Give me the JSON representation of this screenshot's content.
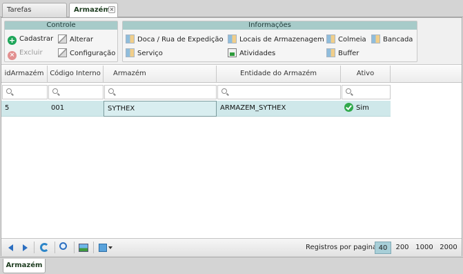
{
  "tabs": [
    {
      "label": "Tarefas Principais",
      "active": false
    },
    {
      "label": "Armazém",
      "active": true,
      "closable": true
    }
  ],
  "ribbon": {
    "controle": {
      "title": "Controle",
      "cadastrar": "Cadastrar",
      "alterar": "Alterar",
      "excluir": "Excluir",
      "configuracao": "Configuração"
    },
    "informacoes": {
      "title": "Informações",
      "doca": "Doca / Rua de Expedição",
      "locais": "Locais de Armazenagem",
      "colmeia": "Colmeia",
      "bancada": "Bancada",
      "servico": "Serviço",
      "atividades": "Atividades",
      "buffer": "Buffer"
    }
  },
  "grid": {
    "columns": [
      "idArmazém",
      "Código Interno",
      "Armazém",
      "Entidade do Armazém",
      "Ativo"
    ],
    "rows": [
      {
        "id": "5",
        "codigo": "001",
        "armazem": "SYTHEX",
        "entidade": "ARMAZEM_SYTHEX",
        "ativo": "Sim"
      }
    ]
  },
  "footer": {
    "per_page_label": "Registros por pagina:",
    "options": [
      "40",
      "200",
      "1000",
      "2000"
    ],
    "selected": "40"
  },
  "bottom_tab": {
    "label": "Armazém"
  },
  "colors": {
    "accent": "#a7cbc9",
    "row_selected": "#cfe8ea",
    "ok": "#31a94c"
  }
}
